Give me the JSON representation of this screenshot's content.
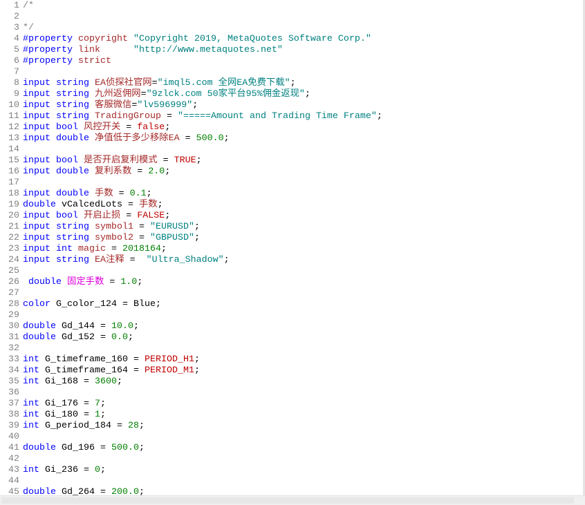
{
  "editor": {
    "lines": [
      {
        "no": "1",
        "tokens": [
          {
            "t": "/*",
            "c": "#808080"
          }
        ]
      },
      {
        "no": "2",
        "tokens": []
      },
      {
        "no": "3",
        "tokens": [
          {
            "t": "*/",
            "c": "#808080"
          }
        ]
      },
      {
        "no": "4",
        "tokens": [
          {
            "t": "#property",
            "c": "#0000ff"
          },
          {
            "t": " "
          },
          {
            "t": "copyright",
            "c": "#a52a2a"
          },
          {
            "t": " "
          },
          {
            "t": "\"Copyright 2019, MetaQuotes Software Corp.\"",
            "c": "#008080"
          }
        ]
      },
      {
        "no": "5",
        "tokens": [
          {
            "t": "#property",
            "c": "#0000ff"
          },
          {
            "t": " "
          },
          {
            "t": "link",
            "c": "#a52a2a"
          },
          {
            "t": "      "
          },
          {
            "t": "\"http://www.metaquotes.net\"",
            "c": "#008080"
          }
        ]
      },
      {
        "no": "6",
        "tokens": [
          {
            "t": "#property",
            "c": "#0000ff"
          },
          {
            "t": " "
          },
          {
            "t": "strict",
            "c": "#a52a2a"
          }
        ]
      },
      {
        "no": "7",
        "tokens": []
      },
      {
        "no": "8",
        "tokens": [
          {
            "t": "input",
            "c": "#0000ff"
          },
          {
            "t": " "
          },
          {
            "t": "string",
            "c": "#0000ff"
          },
          {
            "t": " "
          },
          {
            "t": "EA侦探社官网",
            "c": "#a52a2a"
          },
          {
            "t": "="
          },
          {
            "t": "\"imql5.com 全网EA免费下载\"",
            "c": "#008080"
          },
          {
            "t": ";"
          }
        ]
      },
      {
        "no": "9",
        "tokens": [
          {
            "t": "input",
            "c": "#0000ff"
          },
          {
            "t": " "
          },
          {
            "t": "string",
            "c": "#0000ff"
          },
          {
            "t": " "
          },
          {
            "t": "九州返佣网",
            "c": "#a52a2a"
          },
          {
            "t": "="
          },
          {
            "t": "\"9zlck.com 50家平台95%佣金返现\"",
            "c": "#008080"
          },
          {
            "t": ";"
          }
        ]
      },
      {
        "no": "10",
        "tokens": [
          {
            "t": "input",
            "c": "#0000ff"
          },
          {
            "t": " "
          },
          {
            "t": "string",
            "c": "#0000ff"
          },
          {
            "t": " "
          },
          {
            "t": "客服微信",
            "c": "#a52a2a"
          },
          {
            "t": "="
          },
          {
            "t": "\"lv596999\"",
            "c": "#008080"
          },
          {
            "t": ";"
          }
        ]
      },
      {
        "no": "11",
        "tokens": [
          {
            "t": "input",
            "c": "#0000ff"
          },
          {
            "t": " "
          },
          {
            "t": "string",
            "c": "#0000ff"
          },
          {
            "t": " "
          },
          {
            "t": "TradingGroup",
            "c": "#a52a2a"
          },
          {
            "t": " = "
          },
          {
            "t": "\"=====Amount and Trading Time Frame\"",
            "c": "#008080"
          },
          {
            "t": ";"
          }
        ]
      },
      {
        "no": "12",
        "tokens": [
          {
            "t": "input",
            "c": "#0000ff"
          },
          {
            "t": " "
          },
          {
            "t": "bool",
            "c": "#0000ff"
          },
          {
            "t": " "
          },
          {
            "t": "风控开关",
            "c": "#a52a2a"
          },
          {
            "t": " = "
          },
          {
            "t": "false",
            "c": "#c00000"
          },
          {
            "t": ";"
          }
        ]
      },
      {
        "no": "13",
        "tokens": [
          {
            "t": "input",
            "c": "#0000ff"
          },
          {
            "t": " "
          },
          {
            "t": "double",
            "c": "#0000ff"
          },
          {
            "t": " "
          },
          {
            "t": "净值低于多少移除EA",
            "c": "#a52a2a"
          },
          {
            "t": " = "
          },
          {
            "t": "500.0",
            "c": "#008000"
          },
          {
            "t": ";"
          }
        ]
      },
      {
        "no": "14",
        "tokens": []
      },
      {
        "no": "15",
        "tokens": [
          {
            "t": "input",
            "c": "#0000ff"
          },
          {
            "t": " "
          },
          {
            "t": "bool",
            "c": "#0000ff"
          },
          {
            "t": " "
          },
          {
            "t": "是否开启复利模式",
            "c": "#a52a2a"
          },
          {
            "t": " = "
          },
          {
            "t": "TRUE",
            "c": "#c00000"
          },
          {
            "t": ";"
          }
        ]
      },
      {
        "no": "16",
        "tokens": [
          {
            "t": "input",
            "c": "#0000ff"
          },
          {
            "t": " "
          },
          {
            "t": "double",
            "c": "#0000ff"
          },
          {
            "t": " "
          },
          {
            "t": "复利系数",
            "c": "#a52a2a"
          },
          {
            "t": " = "
          },
          {
            "t": "2.0",
            "c": "#008000"
          },
          {
            "t": ";"
          }
        ]
      },
      {
        "no": "17",
        "tokens": []
      },
      {
        "no": "18",
        "tokens": [
          {
            "t": "input",
            "c": "#0000ff"
          },
          {
            "t": " "
          },
          {
            "t": "double",
            "c": "#0000ff"
          },
          {
            "t": " "
          },
          {
            "t": "手数",
            "c": "#a52a2a"
          },
          {
            "t": " = "
          },
          {
            "t": "0.1",
            "c": "#008000"
          },
          {
            "t": ";"
          }
        ]
      },
      {
        "no": "19",
        "tokens": [
          {
            "t": "double",
            "c": "#0000ff"
          },
          {
            "t": " "
          },
          {
            "t": "vCalcedLots"
          },
          {
            "t": " = "
          },
          {
            "t": "手数",
            "c": "#a52a2a"
          },
          {
            "t": ";"
          }
        ]
      },
      {
        "no": "20",
        "tokens": [
          {
            "t": "input",
            "c": "#0000ff"
          },
          {
            "t": " "
          },
          {
            "t": "bool",
            "c": "#0000ff"
          },
          {
            "t": " "
          },
          {
            "t": "开启止损",
            "c": "#a52a2a"
          },
          {
            "t": " = "
          },
          {
            "t": "FALSE",
            "c": "#c00000"
          },
          {
            "t": ";"
          }
        ]
      },
      {
        "no": "21",
        "tokens": [
          {
            "t": "input",
            "c": "#0000ff"
          },
          {
            "t": " "
          },
          {
            "t": "string",
            "c": "#0000ff"
          },
          {
            "t": " "
          },
          {
            "t": "symbol1",
            "c": "#a52a2a"
          },
          {
            "t": " = "
          },
          {
            "t": "\"EURUSD\"",
            "c": "#008080"
          },
          {
            "t": ";"
          }
        ]
      },
      {
        "no": "22",
        "tokens": [
          {
            "t": "input",
            "c": "#0000ff"
          },
          {
            "t": " "
          },
          {
            "t": "string",
            "c": "#0000ff"
          },
          {
            "t": " "
          },
          {
            "t": "symbol2",
            "c": "#a52a2a"
          },
          {
            "t": " = "
          },
          {
            "t": "\"GBPUSD\"",
            "c": "#008080"
          },
          {
            "t": ";"
          }
        ]
      },
      {
        "no": "23",
        "tokens": [
          {
            "t": "input",
            "c": "#0000ff"
          },
          {
            "t": " "
          },
          {
            "t": "int",
            "c": "#0000ff"
          },
          {
            "t": " "
          },
          {
            "t": "magic",
            "c": "#a52a2a"
          },
          {
            "t": " = "
          },
          {
            "t": "2018164",
            "c": "#008000"
          },
          {
            "t": ";"
          }
        ]
      },
      {
        "no": "24",
        "tokens": [
          {
            "t": "input",
            "c": "#0000ff"
          },
          {
            "t": " "
          },
          {
            "t": "string",
            "c": "#0000ff"
          },
          {
            "t": " "
          },
          {
            "t": "EA注释",
            "c": "#a52a2a"
          },
          {
            "t": " =  "
          },
          {
            "t": "\"Ultra_Shadow\"",
            "c": "#008080"
          },
          {
            "t": ";"
          }
        ]
      },
      {
        "no": "25",
        "tokens": []
      },
      {
        "no": "26",
        "tokens": [
          {
            "t": " "
          },
          {
            "t": "double",
            "c": "#0000ff"
          },
          {
            "t": " "
          },
          {
            "t": "固定手数",
            "c": "#dd00dd"
          },
          {
            "t": " = "
          },
          {
            "t": "1.0",
            "c": "#008000"
          },
          {
            "t": ";"
          }
        ]
      },
      {
        "no": "27",
        "tokens": []
      },
      {
        "no": "28",
        "tokens": [
          {
            "t": "color",
            "c": "#0000ff"
          },
          {
            "t": " "
          },
          {
            "t": "G_color_124"
          },
          {
            "t": " = "
          },
          {
            "t": "Blue"
          },
          {
            "t": ";"
          }
        ]
      },
      {
        "no": "29",
        "tokens": []
      },
      {
        "no": "30",
        "tokens": [
          {
            "t": "double",
            "c": "#0000ff"
          },
          {
            "t": " "
          },
          {
            "t": "Gd_144"
          },
          {
            "t": " = "
          },
          {
            "t": "10.0",
            "c": "#008000"
          },
          {
            "t": ";"
          }
        ]
      },
      {
        "no": "31",
        "tokens": [
          {
            "t": "double",
            "c": "#0000ff"
          },
          {
            "t": " "
          },
          {
            "t": "Gd_152"
          },
          {
            "t": " = "
          },
          {
            "t": "0.0",
            "c": "#008000"
          },
          {
            "t": ";"
          }
        ]
      },
      {
        "no": "32",
        "tokens": []
      },
      {
        "no": "33",
        "tokens": [
          {
            "t": "int",
            "c": "#0000ff"
          },
          {
            "t": " "
          },
          {
            "t": "G_timeframe_160"
          },
          {
            "t": " = "
          },
          {
            "t": "PERIOD_H1",
            "c": "#c00000"
          },
          {
            "t": ";"
          }
        ]
      },
      {
        "no": "34",
        "tokens": [
          {
            "t": "int",
            "c": "#0000ff"
          },
          {
            "t": " "
          },
          {
            "t": "G_timeframe_164"
          },
          {
            "t": " = "
          },
          {
            "t": "PERIOD_M1",
            "c": "#c00000"
          },
          {
            "t": ";"
          }
        ]
      },
      {
        "no": "35",
        "tokens": [
          {
            "t": "int",
            "c": "#0000ff"
          },
          {
            "t": " "
          },
          {
            "t": "Gi_168"
          },
          {
            "t": " = "
          },
          {
            "t": "3600",
            "c": "#008000"
          },
          {
            "t": ";"
          }
        ]
      },
      {
        "no": "36",
        "tokens": []
      },
      {
        "no": "37",
        "tokens": [
          {
            "t": "int",
            "c": "#0000ff"
          },
          {
            "t": " "
          },
          {
            "t": "Gi_176"
          },
          {
            "t": " = "
          },
          {
            "t": "7",
            "c": "#008000"
          },
          {
            "t": ";"
          }
        ]
      },
      {
        "no": "38",
        "tokens": [
          {
            "t": "int",
            "c": "#0000ff"
          },
          {
            "t": " "
          },
          {
            "t": "Gi_180"
          },
          {
            "t": " = "
          },
          {
            "t": "1",
            "c": "#008000"
          },
          {
            "t": ";"
          }
        ]
      },
      {
        "no": "39",
        "tokens": [
          {
            "t": "int",
            "c": "#0000ff"
          },
          {
            "t": " "
          },
          {
            "t": "G_period_184"
          },
          {
            "t": " = "
          },
          {
            "t": "28",
            "c": "#008000"
          },
          {
            "t": ";"
          }
        ]
      },
      {
        "no": "40",
        "tokens": []
      },
      {
        "no": "41",
        "tokens": [
          {
            "t": "double",
            "c": "#0000ff"
          },
          {
            "t": " "
          },
          {
            "t": "Gd_196"
          },
          {
            "t": " = "
          },
          {
            "t": "500.0",
            "c": "#008000"
          },
          {
            "t": ";"
          }
        ]
      },
      {
        "no": "42",
        "tokens": []
      },
      {
        "no": "43",
        "tokens": [
          {
            "t": "int",
            "c": "#0000ff"
          },
          {
            "t": " "
          },
          {
            "t": "Gi_236"
          },
          {
            "t": " = "
          },
          {
            "t": "0",
            "c": "#008000"
          },
          {
            "t": ";"
          }
        ]
      },
      {
        "no": "44",
        "tokens": []
      },
      {
        "no": "45",
        "tokens": [
          {
            "t": "double",
            "c": "#0000ff"
          },
          {
            "t": " "
          },
          {
            "t": "Gd_264"
          },
          {
            "t": " = "
          },
          {
            "t": "200.0",
            "c": "#008000"
          },
          {
            "t": ";"
          }
        ]
      }
    ]
  }
}
